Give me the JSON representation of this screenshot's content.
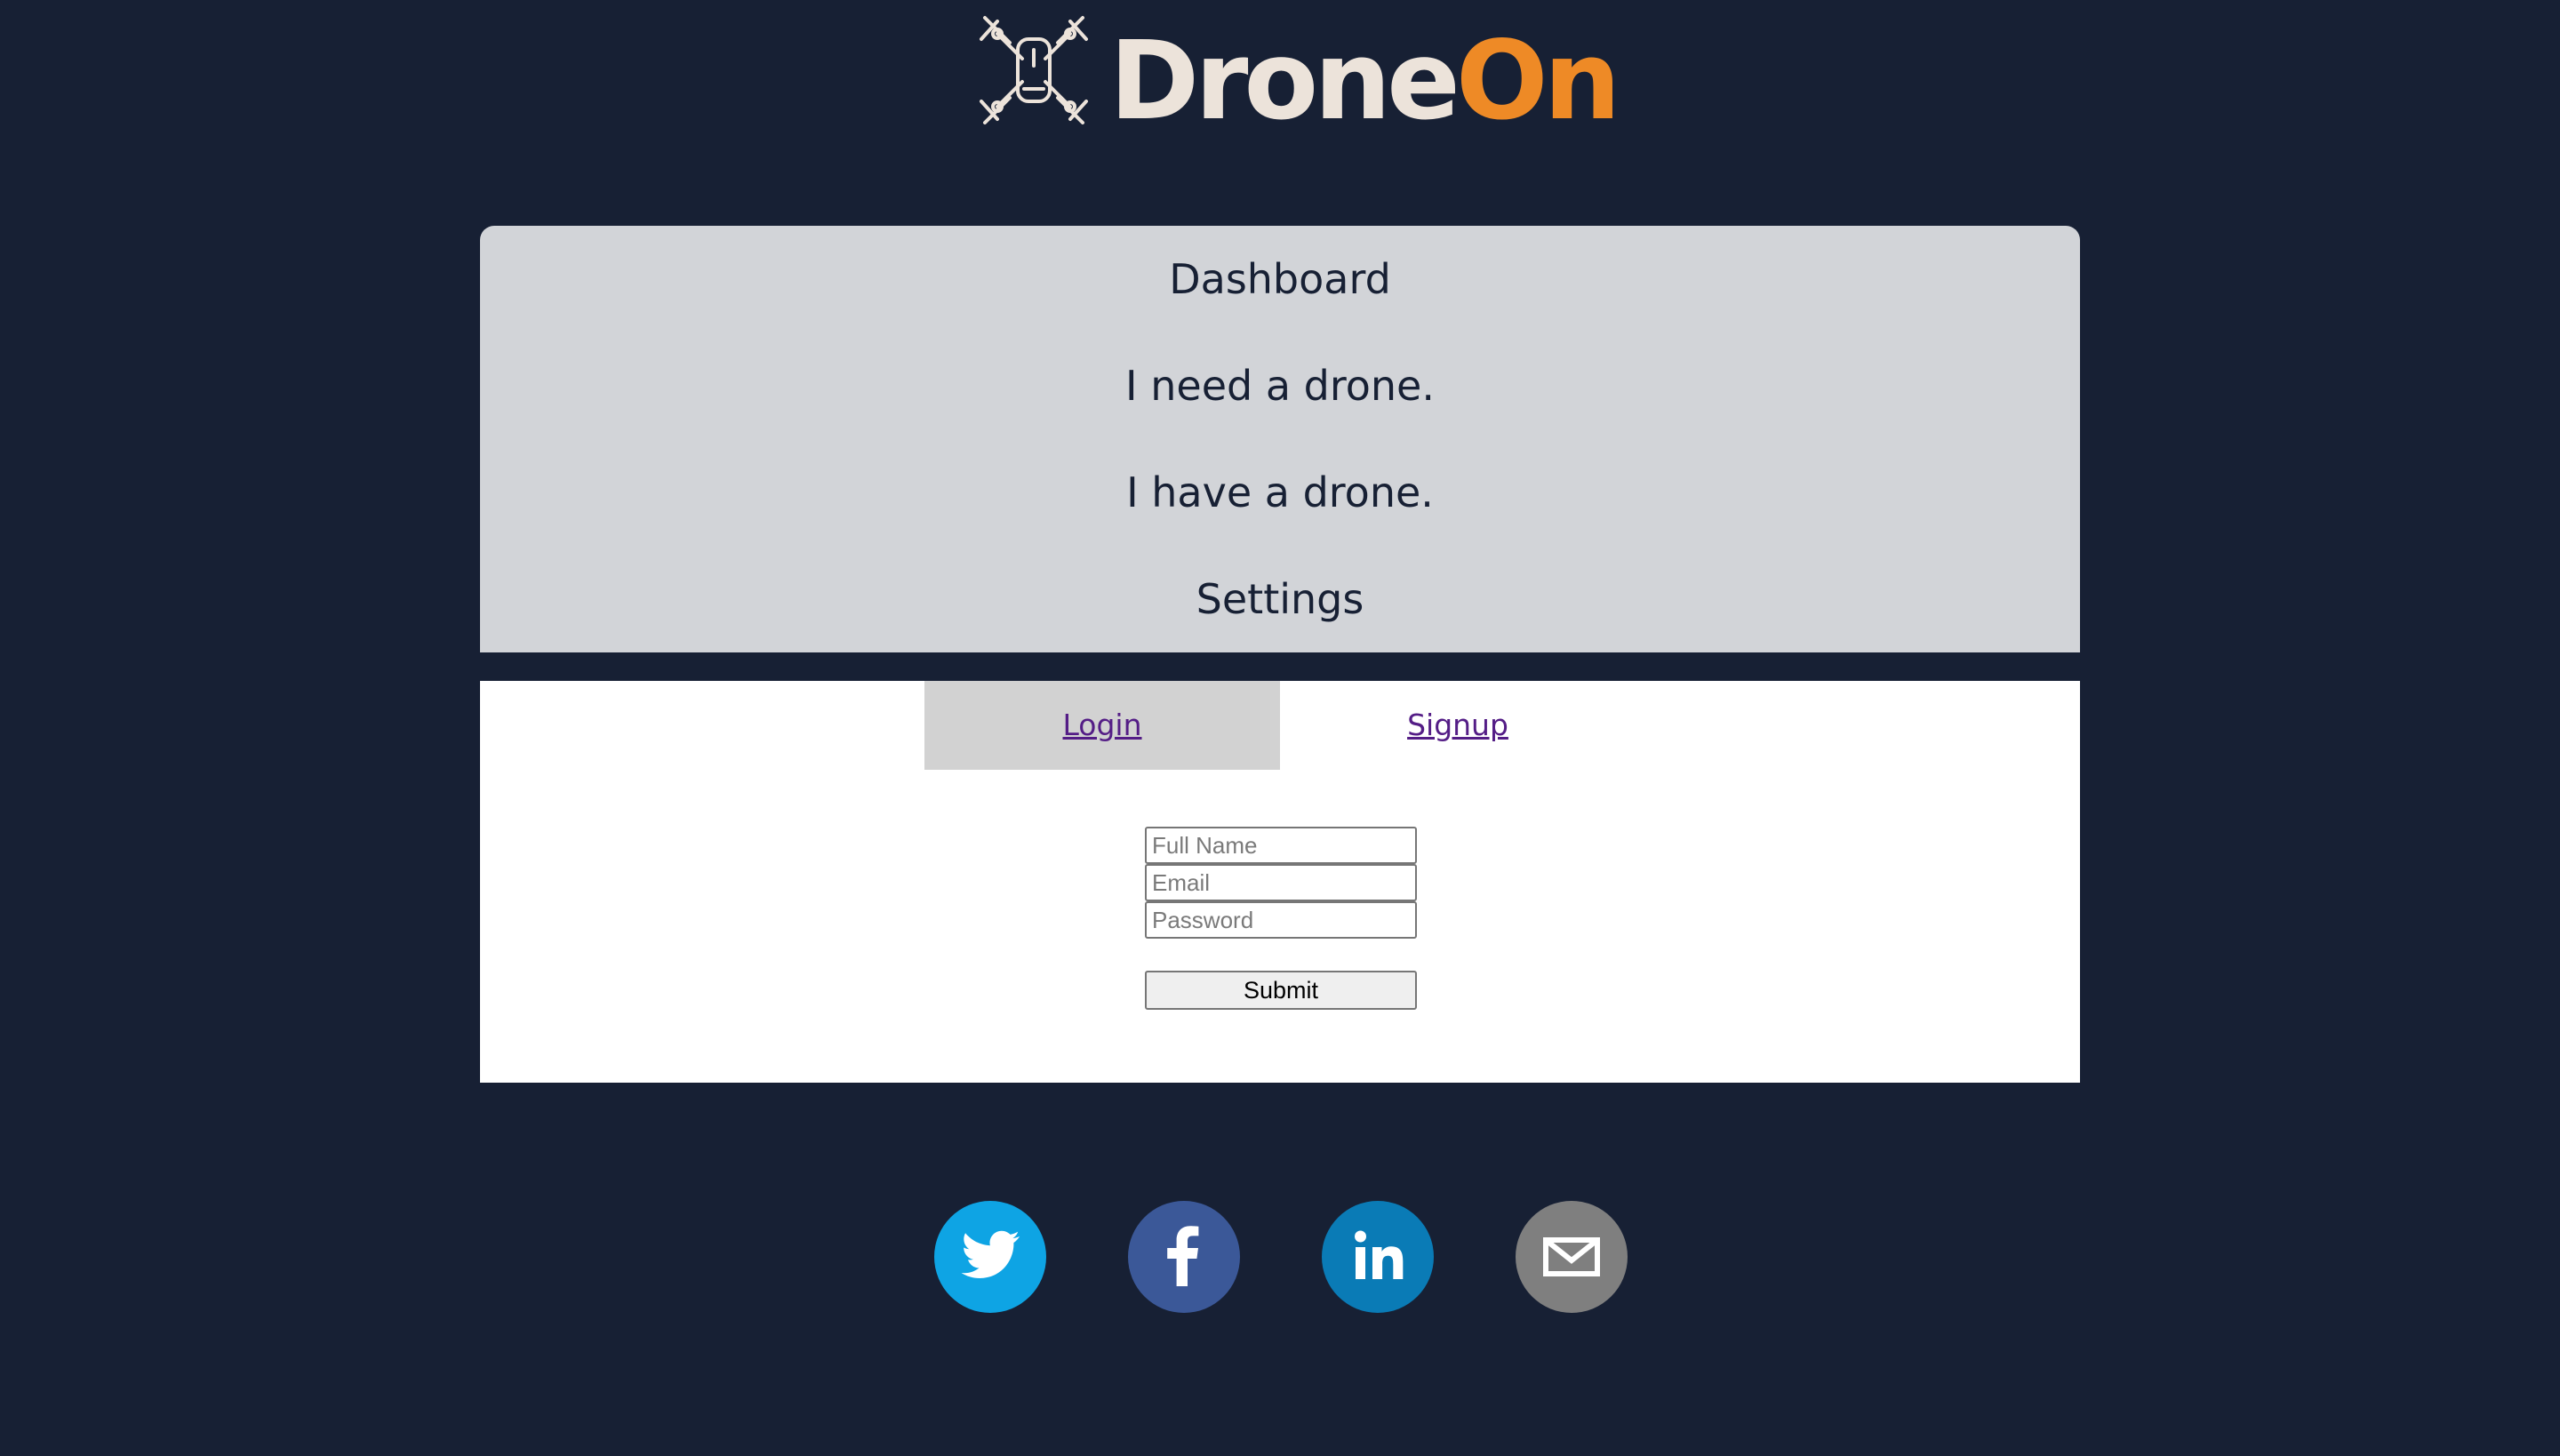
{
  "brand": {
    "name_part1": "Drone",
    "name_part2": "On",
    "color_part1": "#ece3da",
    "color_part2": "#ee8a26",
    "logo_icon": "drone-icon"
  },
  "nav": {
    "items": [
      {
        "label": "Dashboard"
      },
      {
        "label": "I need a drone."
      },
      {
        "label": "I have a drone."
      },
      {
        "label": "Settings"
      }
    ]
  },
  "auth": {
    "tabs": {
      "login": "Login",
      "signup": "Signup"
    },
    "active_tab": "Login",
    "fields": {
      "full_name": {
        "value": "",
        "placeholder": "Full Name"
      },
      "email": {
        "value": "",
        "placeholder": "Email"
      },
      "password": {
        "value": "",
        "placeholder": "Password"
      }
    },
    "submit_label": "Submit"
  },
  "social": [
    {
      "name": "twitter",
      "icon": "twitter-icon",
      "color": "#0ea4e4"
    },
    {
      "name": "facebook",
      "icon": "facebook-icon",
      "color": "#3b5898"
    },
    {
      "name": "linkedin",
      "icon": "linkedin-icon",
      "color": "#0a7bb6"
    },
    {
      "name": "email",
      "icon": "mail-icon",
      "color": "#7f7f7f"
    }
  ],
  "theme": {
    "background": "#172034",
    "menu_background": "#d2d4d8",
    "active_tab_background": "#d2d2d2",
    "link_color": "#541d86"
  }
}
